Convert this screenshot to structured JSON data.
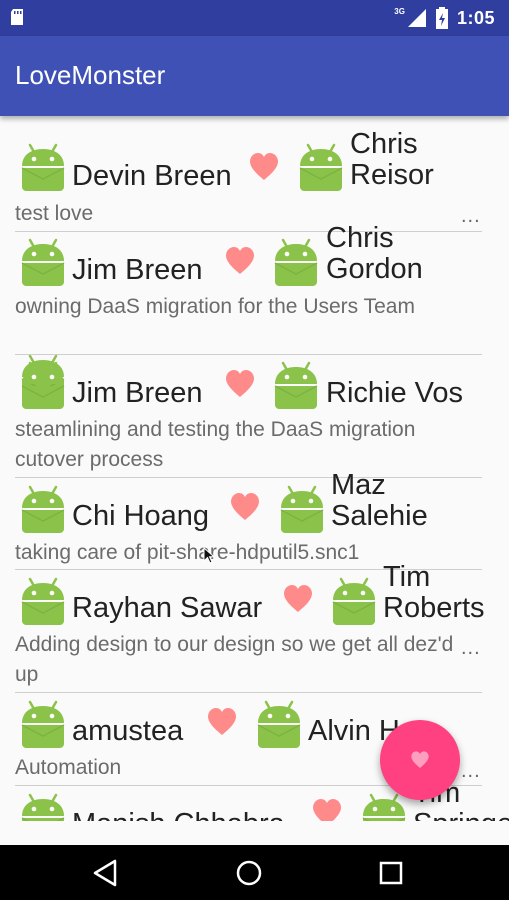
{
  "status_bar": {
    "network": "3G",
    "time": "1:05"
  },
  "app_bar": {
    "title": "LoveMonster"
  },
  "love_list": [
    {
      "giver": "Devin Breen",
      "receiver": "Chris Reisor",
      "note": "test love",
      "truncated": true,
      "ellipsis": "..."
    },
    {
      "giver": "Jim Breen",
      "receiver": "Chris Gordon",
      "note": "owning DaaS migration for the Users Team",
      "truncated": false,
      "ellipsis": ""
    },
    {
      "giver": "Jim Breen",
      "receiver": "Richie Vos",
      "note": "steamlining and testing the DaaS migration cutover process",
      "truncated": false,
      "ellipsis": ""
    },
    {
      "giver": "Chi Hoang",
      "receiver": "Maz Salehie",
      "note": "taking care of pit-share-hdputil5.snc1",
      "truncated": false,
      "ellipsis": ""
    },
    {
      "giver": "Rayhan Sawar",
      "receiver": "Tim Roberts",
      "note": "Adding design to our design so we get all dez'd up",
      "truncated": true,
      "ellipsis": "..."
    },
    {
      "giver": "amustea",
      "receiver": "Alvin Ho",
      "note": "Automation",
      "truncated": true,
      "ellipsis": "..."
    },
    {
      "giver": "Manish Chhabra",
      "receiver": "Tim Springer",
      "note": "",
      "truncated": false,
      "ellipsis": ""
    }
  ],
  "fab": {
    "icon": "heart-icon",
    "color": "#ff4081"
  },
  "colors": {
    "primary": "#3f51b5",
    "primary_dark": "#303f9f",
    "accent": "#ff4081",
    "android_green": "#8bc34a",
    "heart": "#ff8a8a"
  }
}
